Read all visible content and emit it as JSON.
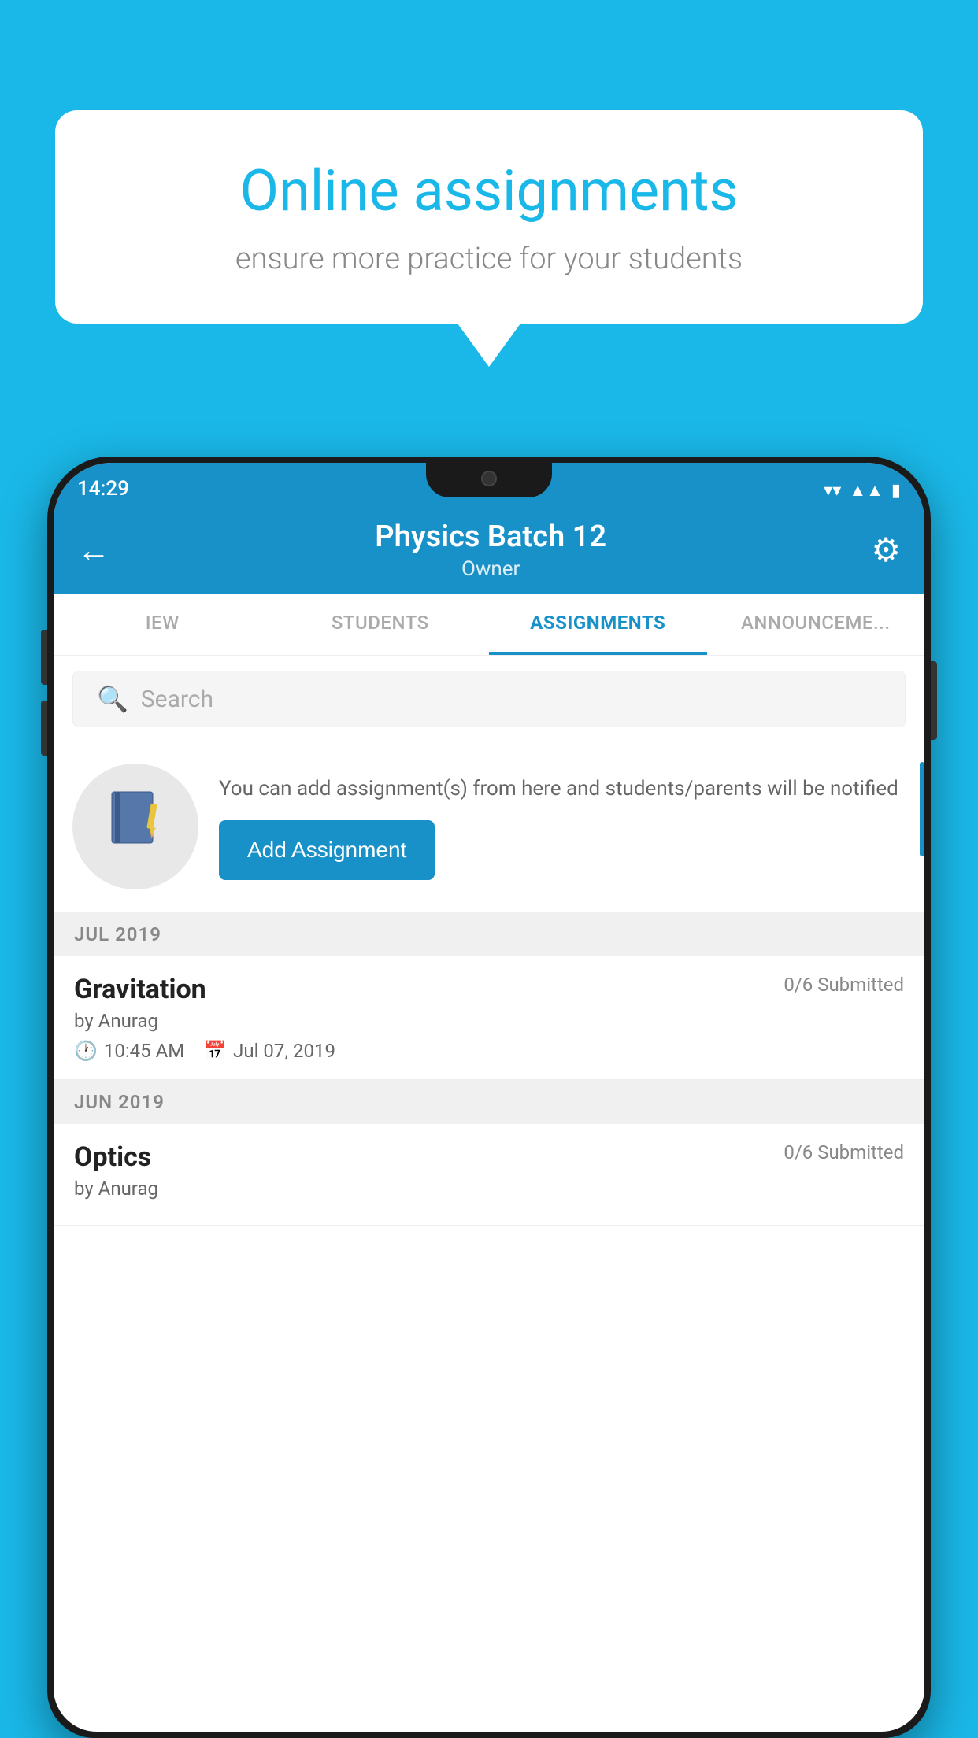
{
  "background": {
    "color": "#1ab8e8"
  },
  "speech_bubble": {
    "title": "Online assignments",
    "subtitle": "ensure more practice for your students"
  },
  "phone": {
    "status_bar": {
      "time": "14:29",
      "wifi": "▼",
      "signal": "▲",
      "battery": "▮"
    },
    "app_bar": {
      "title": "Physics Batch 12",
      "subtitle": "Owner",
      "back_label": "←",
      "settings_label": "⚙"
    },
    "tabs": [
      {
        "label": "IEW",
        "active": false
      },
      {
        "label": "STUDENTS",
        "active": false
      },
      {
        "label": "ASSIGNMENTS",
        "active": true
      },
      {
        "label": "ANNOUNCEM...",
        "active": false
      }
    ],
    "search": {
      "placeholder": "Search"
    },
    "assignment_promo": {
      "icon": "📓",
      "description": "You can add assignment(s) from here and students/parents will be notified",
      "button_label": "Add Assignment"
    },
    "sections": [
      {
        "month_label": "JUL 2019",
        "assignments": [
          {
            "title": "Gravitation",
            "submitted": "0/6 Submitted",
            "author": "by Anurag",
            "time": "10:45 AM",
            "date": "Jul 07, 2019"
          }
        ]
      },
      {
        "month_label": "JUN 2019",
        "assignments": [
          {
            "title": "Optics",
            "submitted": "0/6 Submitted",
            "author": "by Anurag",
            "time": "",
            "date": ""
          }
        ]
      }
    ]
  }
}
